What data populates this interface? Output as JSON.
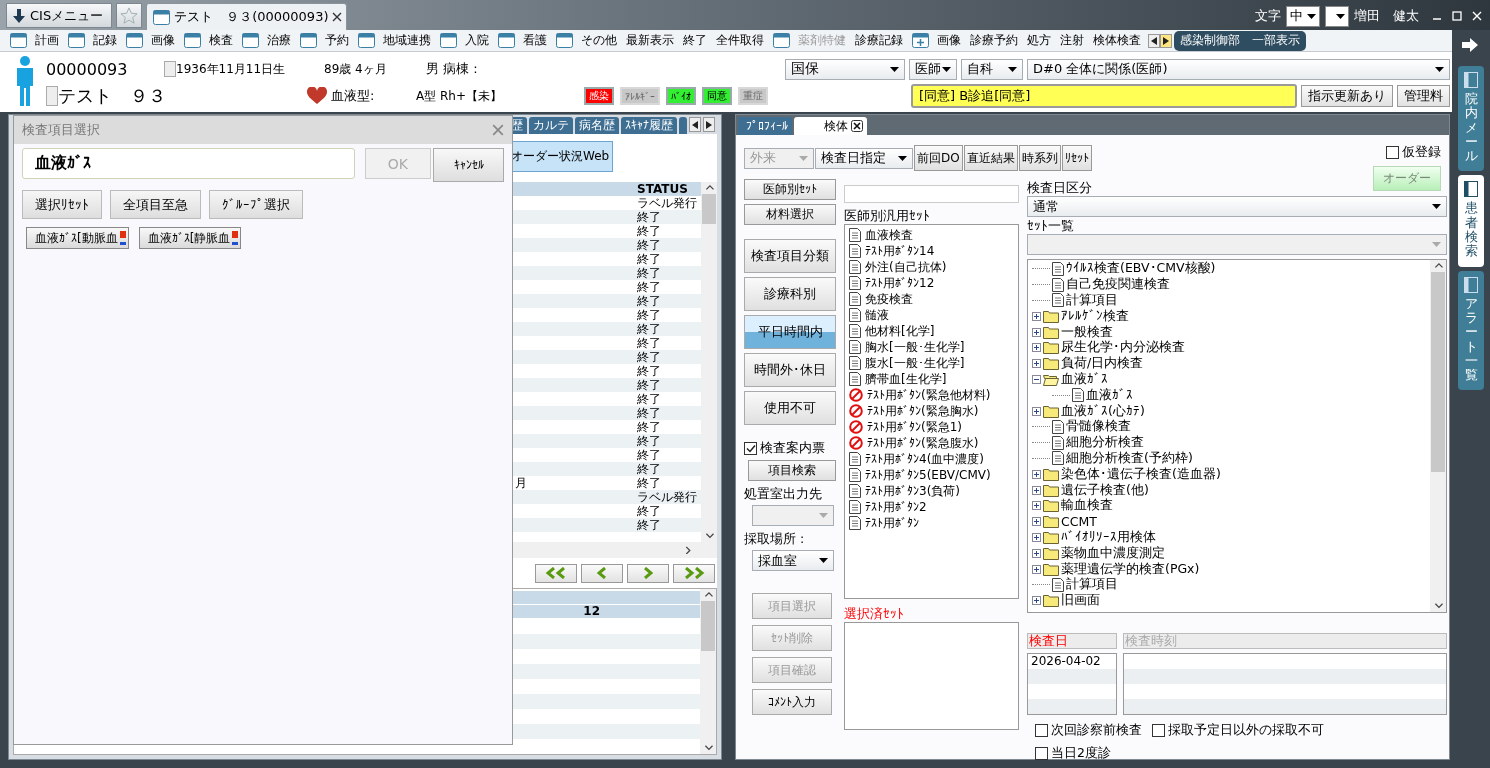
{
  "title_bar": {
    "menu_button": "CISメニュー",
    "tabs": [
      {
        "label": "テスト　９３(00000093)",
        "selected": true
      }
    ],
    "font_label": "文字",
    "font_size": "中",
    "user": "増田　健太"
  },
  "menu": {
    "items": [
      {
        "label": "計画",
        "icon": true,
        "disabled": false
      },
      {
        "label": "記録",
        "icon": true,
        "disabled": false
      },
      {
        "label": "画像",
        "icon": true,
        "disabled": false
      },
      {
        "label": "検査",
        "icon": true,
        "disabled": false
      },
      {
        "label": "治療",
        "icon": true,
        "disabled": false
      },
      {
        "label": "予約",
        "icon": true,
        "disabled": false
      },
      {
        "label": "地域連携",
        "icon": true,
        "disabled": false
      },
      {
        "label": "入院",
        "icon": true,
        "disabled": false
      },
      {
        "label": "看護",
        "icon": true,
        "disabled": false
      },
      {
        "label": "その他",
        "icon": true,
        "disabled": false
      },
      {
        "label": "最新表示",
        "icon": false,
        "disabled": false
      },
      {
        "label": "終了",
        "icon": false,
        "disabled": false
      },
      {
        "label": "全件取得",
        "icon": false,
        "disabled": false
      },
      {
        "label": "薬剤特健",
        "icon": true,
        "disabled": true
      },
      {
        "label": "診療記録",
        "icon": false,
        "disabled": false
      },
      {
        "label": "画像",
        "icon": true,
        "disabled": false
      },
      {
        "label": "診療予約",
        "icon": false,
        "disabled": false
      },
      {
        "label": "処方",
        "icon": false,
        "disabled": false
      },
      {
        "label": "注射",
        "icon": false,
        "disabled": false
      },
      {
        "label": "検体検査",
        "icon": false,
        "disabled": false
      }
    ],
    "badge": "感染制御部　一部表示"
  },
  "patient": {
    "id": "00000093",
    "name": "テスト　９３",
    "birth": "1936年11月11日生",
    "age": "89歳 4ヶ月",
    "sex_ward": "男 病棟 :",
    "blood_label": "血液型:",
    "blood_value": "A型 Rh+【未】",
    "flags": [
      {
        "label": "感染",
        "color": "#ff0000",
        "disabled": false
      },
      {
        "label": "ｱﾚﾙｷﾞｰ",
        "color": "#c8c8c8",
        "disabled": true
      },
      {
        "label": "ﾊﾞｲｵ",
        "color": "#33ee33",
        "disabled": false
      },
      {
        "label": "同意",
        "color": "#33ee33",
        "disabled": false
      },
      {
        "label": "重症",
        "color": "#c8c8c8",
        "disabled": true
      }
    ],
    "insurance": "国保",
    "role": "医師",
    "dept": "自科",
    "scope": "D#0  全体に関係(医師)",
    "notice": "[同意] B診追[同意]",
    "buttons": [
      "指示更新あり",
      "管理料"
    ]
  },
  "left_panel": {
    "tabs": [
      {
        "label": "歴",
        "selected": false
      },
      {
        "label": "カルテ",
        "selected": false
      },
      {
        "label": "病名歴",
        "selected": false
      },
      {
        "label": "ｽｷｬﾅ履歴",
        "selected": false
      }
    ],
    "order_status_button": "オーダー状況Web",
    "table": {
      "columns": [
        "STATUS"
      ],
      "rows": [
        {
          "status": "ラベル発行"
        },
        {
          "status": "終了"
        },
        {
          "status": "終了"
        },
        {
          "status": "終了"
        },
        {
          "status": "終了"
        },
        {
          "status": "終了"
        },
        {
          "status": "終了"
        },
        {
          "status": "終了"
        },
        {
          "status": "終了"
        },
        {
          "status": "終了"
        },
        {
          "status": "終了"
        },
        {
          "status": "終了"
        },
        {
          "status": "終了"
        },
        {
          "status": "終了"
        },
        {
          "status": "終了"
        },
        {
          "status": "終了"
        },
        {
          "status": "終了"
        },
        {
          "status": "終了"
        },
        {
          "status": "終了"
        },
        {
          "status": "終了"
        },
        {
          "column_1": "月",
          "status": "終了"
        },
        {
          "status": "ラベル発行"
        },
        {
          "status": "終了"
        },
        {
          "status": "終了"
        }
      ]
    },
    "lower_table": {
      "header_value": "12"
    }
  },
  "dialog": {
    "title": "検査項目選択",
    "search_value": "血液ｶﾞｽ",
    "ok": {
      "label": "OK",
      "disabled": true
    },
    "cancel": "ｷｬﾝｾﾙ",
    "actions": [
      "選択ﾘｾｯﾄ",
      "全項目至急",
      "ｸﾞﾙｰﾌﾟ選択"
    ],
    "items": [
      "血液ｶﾞｽ[動脈血",
      "血液ｶﾞｽ[静脈血"
    ]
  },
  "specimen_panel": {
    "tabs": [
      {
        "label": "ﾌﾟﾛﾌｨｰﾙ",
        "selected": false,
        "closable": false
      },
      {
        "label": "検体",
        "selected": true,
        "closable": true
      }
    ],
    "visit_type": {
      "value": "外来",
      "disabled": true
    },
    "date_mode": "検査日指定",
    "toolbar": [
      "前回DO",
      "直近結果",
      "時系列",
      "ﾘｾｯﾄ"
    ],
    "provisional": {
      "label": "仮登録",
      "checked": false
    },
    "order_button": {
      "label": "オーダー",
      "disabled": true
    },
    "set_buttons": [
      "医師別ｾｯﾄ",
      "材料選択"
    ],
    "categories": [
      {
        "label": "検査項目分類",
        "selected": false
      },
      {
        "label": "診療科別",
        "selected": false
      },
      {
        "label": "平日時間内",
        "selected": true
      },
      {
        "label": "時間外･休日",
        "selected": false
      },
      {
        "label": "使用不可",
        "selected": false
      }
    ],
    "guide_ticket": {
      "label": "検査案内票",
      "checked": true
    },
    "item_search": "項目検索",
    "output_label": "処置室出力先",
    "output_disabled": true,
    "place_label": "採取場所 :",
    "place": "採血室",
    "actions": [
      {
        "label": "項目選択",
        "disabled": true
      },
      {
        "label": "ｾｯﾄ削除",
        "disabled": true
      },
      {
        "label": "項目確認",
        "disabled": true
      },
      {
        "label": "ｺﾒﾝﾄ入力",
        "disabled": false
      }
    ],
    "sets_label": "医師別汎用ｾｯﾄ",
    "sets": [
      {
        "label": "血液検査",
        "kind": "doc"
      },
      {
        "label": "ﾃｽﾄ用ﾎﾞﾀﾝ14",
        "kind": "doc"
      },
      {
        "label": "外注(自己抗体)",
        "kind": "doc"
      },
      {
        "label": "ﾃｽﾄ用ﾎﾞﾀﾝ12",
        "kind": "doc"
      },
      {
        "label": "免疫検査",
        "kind": "doc"
      },
      {
        "label": "髄液",
        "kind": "doc"
      },
      {
        "label": "他材料[化学]",
        "kind": "doc"
      },
      {
        "label": "胸水[一般･生化学]",
        "kind": "doc"
      },
      {
        "label": "腹水[一般･生化学]",
        "kind": "doc"
      },
      {
        "label": "臍帯血[生化学]",
        "kind": "doc"
      },
      {
        "label": "ﾃｽﾄ用ﾎﾞﾀﾝ(緊急他材料)",
        "kind": "blocked"
      },
      {
        "label": "ﾃｽﾄ用ﾎﾞﾀﾝ(緊急胸水)",
        "kind": "blocked"
      },
      {
        "label": "ﾃｽﾄ用ﾎﾞﾀﾝ(緊急1)",
        "kind": "blocked"
      },
      {
        "label": "ﾃｽﾄ用ﾎﾞﾀﾝ(緊急腹水)",
        "kind": "blocked"
      },
      {
        "label": "ﾃｽﾄ用ﾎﾞﾀﾝ4(血中濃度)",
        "kind": "doc"
      },
      {
        "label": "ﾃｽﾄ用ﾎﾞﾀﾝ5(EBV/CMV)",
        "kind": "doc"
      },
      {
        "label": "ﾃｽﾄ用ﾎﾞﾀﾝ3(負荷)",
        "kind": "doc"
      },
      {
        "label": "ﾃｽﾄ用ﾎﾞﾀﾝ2",
        "kind": "doc"
      },
      {
        "label": "ﾃｽﾄ用ﾎﾞﾀﾝ",
        "kind": "doc"
      }
    ],
    "selected_sets_label": "選択済ｾｯﾄ",
    "date_class_label": "検査日区分",
    "date_class": "通常",
    "set_list_label": "ｾｯﾄ一覧",
    "set_list_disabled": true,
    "tree": [
      {
        "label": "ｳｲﾙｽ検査(EBV･CMV核酸)",
        "kind": "doc"
      },
      {
        "label": "自己免疫関連検査",
        "kind": "doc"
      },
      {
        "label": "計算項目",
        "kind": "doc"
      },
      {
        "label": "ｱﾚﾙｹﾞﾝ検査",
        "kind": "folder",
        "expanded": false
      },
      {
        "label": "一般検査",
        "kind": "folder",
        "expanded": false
      },
      {
        "label": "尿生化学･内分泌検査",
        "kind": "folder",
        "expanded": false
      },
      {
        "label": "負荷/日内検査",
        "kind": "folder",
        "expanded": false
      },
      {
        "label": "血液ｶﾞｽ",
        "kind": "folder",
        "expanded": true,
        "children": [
          {
            "label": "血液ｶﾞｽ",
            "kind": "doc"
          }
        ]
      },
      {
        "label": "血液ｶﾞｽ(心ｶﾃ)",
        "kind": "folder",
        "expanded": false
      },
      {
        "label": "骨髄像検査",
        "kind": "doc"
      },
      {
        "label": "細胞分析検査",
        "kind": "doc"
      },
      {
        "label": "細胞分析検査(予約枠)",
        "kind": "doc"
      },
      {
        "label": "染色体･遺伝子検査(造血器)",
        "kind": "folder",
        "expanded": false
      },
      {
        "label": "遺伝子検査(他)",
        "kind": "folder",
        "expanded": false
      },
      {
        "label": "輸血検査",
        "kind": "folder",
        "expanded": false
      },
      {
        "label": "CCMT",
        "kind": "folder",
        "expanded": false
      },
      {
        "label": "ﾊﾞｲｵﾘｿｰｽ用検体",
        "kind": "folder",
        "expanded": false
      },
      {
        "label": "薬物血中濃度測定",
        "kind": "folder",
        "expanded": false
      },
      {
        "label": "薬理遺伝学的検査(PGx)",
        "kind": "folder",
        "expanded": false
      },
      {
        "label": "計算項目",
        "kind": "doc"
      },
      {
        "label": "旧画面",
        "kind": "folder",
        "expanded": false
      }
    ],
    "date_header": "検査日",
    "dates": [
      "2026-04-02"
    ],
    "time_header": "検査時刻",
    "options": [
      {
        "label": "次回診察前検査",
        "checked": false
      },
      {
        "label": "採取予定日以外の採取不可",
        "checked": false
      },
      {
        "label": "当日2度診",
        "checked": false
      }
    ]
  },
  "side_tabs": [
    {
      "label": "院内メール",
      "selected": false
    },
    {
      "label": "患者検索",
      "selected": true
    },
    {
      "label": "アラート一覧",
      "selected": false
    }
  ]
}
